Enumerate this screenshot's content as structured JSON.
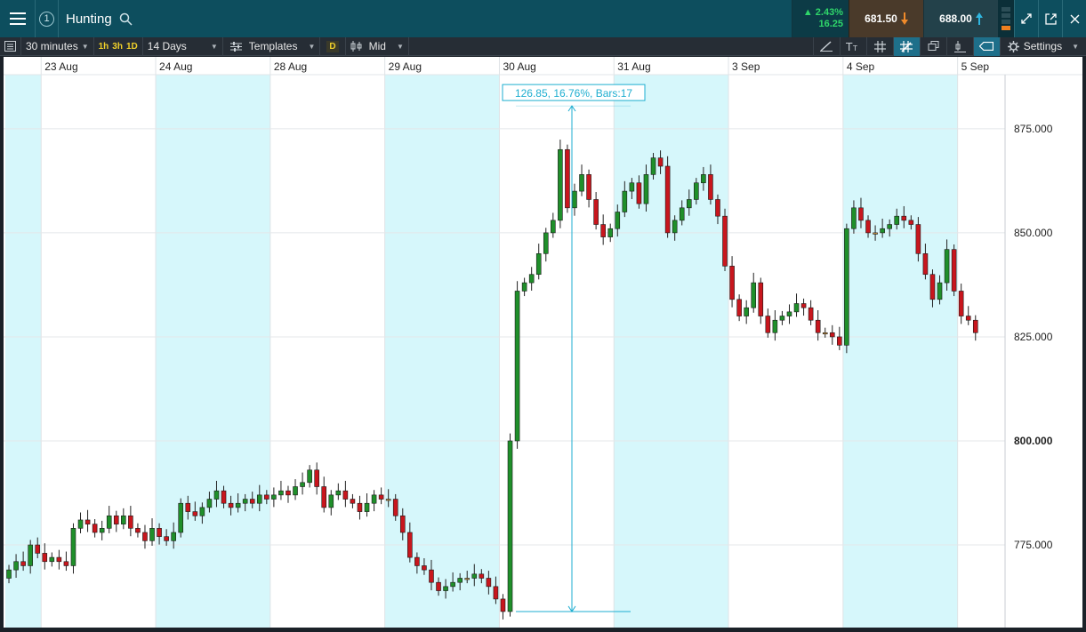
{
  "header": {
    "instrument": "Hunting",
    "change_pct": "2.43%",
    "change_abs": "16.25",
    "sell_price": "681.50",
    "buy_price": "688.00"
  },
  "toolbar": {
    "interval": "30 minutes",
    "quick_intervals": [
      "1h",
      "3h",
      "1D"
    ],
    "range": "14 Days",
    "templates": "Templates",
    "d_badge": "D",
    "price_type": "Mid",
    "settings": "Settings"
  },
  "colors": {
    "up": "#1f8f2a",
    "down": "#c8161d",
    "doji": "#e0a040",
    "session_shade": "#d6f7fb",
    "measure": "#1eaed0"
  },
  "measure_label": "126.85, 16.76%, Bars:17",
  "chart_data": {
    "type": "candlestick",
    "y_ticks": [
      "875.000",
      "850.000",
      "825.000",
      "800.000",
      "775.000"
    ],
    "y_tick_values": [
      875,
      850,
      825,
      800,
      775
    ],
    "ylim": [
      756,
      888
    ],
    "days": [
      {
        "label": "",
        "shaded": true,
        "bars": 5
      },
      {
        "label": "23 Aug",
        "shaded": false,
        "bars": 16
      },
      {
        "label": "24 Aug",
        "shaded": true,
        "bars": 16
      },
      {
        "label": "28 Aug",
        "shaded": false,
        "bars": 16
      },
      {
        "label": "29 Aug",
        "shaded": true,
        "bars": 16
      },
      {
        "label": "30 Aug",
        "shaded": false,
        "bars": 16
      },
      {
        "label": "31 Aug",
        "shaded": true,
        "bars": 16
      },
      {
        "label": "3 Sep",
        "shaded": false,
        "bars": 16
      },
      {
        "label": "4 Sep",
        "shaded": true,
        "bars": 16
      },
      {
        "label": "5 Sep",
        "shaded": false,
        "bars": 3
      }
    ],
    "closes": [
      769,
      771,
      770,
      775,
      773,
      771,
      772,
      771,
      770,
      779,
      781,
      780,
      778,
      779,
      782,
      780,
      782,
      779,
      778,
      776,
      779,
      777,
      776,
      778,
      785,
      783,
      782,
      784,
      786,
      788,
      785,
      784,
      785,
      786,
      785,
      787,
      786,
      787,
      788,
      787,
      789,
      790,
      793,
      789,
      784,
      787,
      788,
      786,
      785,
      783,
      785,
      787,
      786,
      786,
      782,
      778,
      772,
      770,
      769,
      766,
      764,
      765,
      766,
      767,
      767,
      768,
      767,
      765,
      762,
      759,
      800,
      836,
      838,
      840,
      845,
      850,
      853,
      870,
      856,
      860,
      864,
      858,
      852,
      849,
      851,
      855,
      860,
      862,
      857,
      864,
      868,
      866,
      850,
      853,
      856,
      858,
      862,
      864,
      858,
      854,
      842,
      834,
      830,
      832,
      838,
      830,
      826,
      829,
      830,
      831,
      833,
      832,
      829,
      826,
      826,
      825,
      823,
      851,
      856,
      853,
      850,
      850,
      851,
      852,
      854,
      853,
      852,
      845,
      840,
      834,
      838,
      846,
      836,
      830,
      829,
      826
    ]
  }
}
